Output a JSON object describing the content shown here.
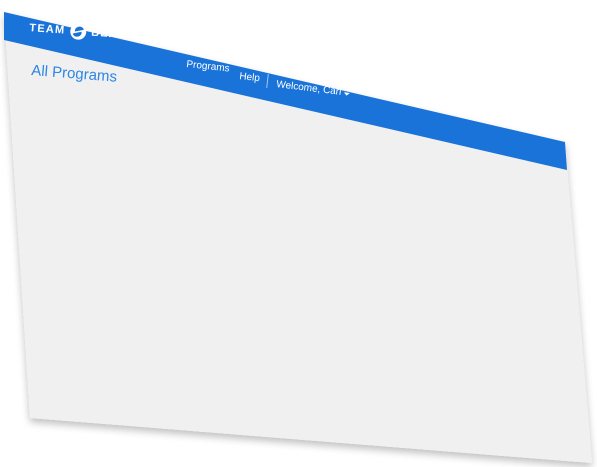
{
  "header": {
    "brand_left": "TEAM",
    "brand_right": "BEACHBODY",
    "brand_tm": "®",
    "nav": {
      "programs_label": "Programs",
      "help_label": "Help",
      "welcome_label": "Welcome, Carl"
    }
  },
  "main": {
    "title": "All Programs"
  },
  "colors": {
    "nav_blue": "#1a73d9",
    "title_blue": "#2b86e6",
    "page_grey": "#f0f0f0"
  },
  "icons": {
    "logo": "beachbody-logo-icon",
    "dropdown": "chevron-down-icon"
  }
}
